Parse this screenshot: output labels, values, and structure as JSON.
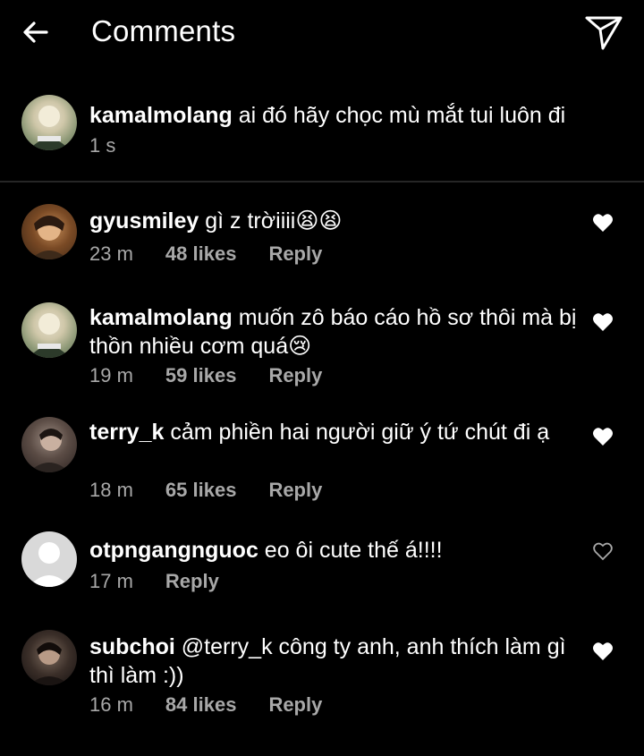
{
  "header": {
    "title": "Comments"
  },
  "caption": {
    "username": "kamalmolang",
    "text": "ai đó hãy chọc mù mắt tui luôn đi",
    "time": "1 s"
  },
  "comments": [
    {
      "username": "gyusmiley",
      "text": "gì z trờiiii😫😫",
      "time": "23 m",
      "likes": "48 likes",
      "reply": "Reply",
      "liked": true
    },
    {
      "username": "kamalmolang",
      "text": "muốn zô báo cáo hồ sơ thôi mà bị thồn nhiều cơm quá😢",
      "time": "19 m",
      "likes": "59 likes",
      "reply": "Reply",
      "liked": true
    },
    {
      "username": "terry_k",
      "text": "cảm phiền hai người giữ ý tứ chút đi ạ",
      "time": "18 m",
      "likes": "65 likes",
      "reply": "Reply",
      "liked": true
    },
    {
      "username": "otpngangnguoc",
      "text": "eo ôi cute thế á!!!!",
      "time": "17 m",
      "reply": "Reply",
      "liked": false
    },
    {
      "username": "subchoi",
      "text": "@terry_k công ty anh, anh thích làm gì thì làm :))",
      "time": "16 m",
      "likes": "84 likes",
      "reply": "Reply",
      "liked": true
    }
  ],
  "colors": {
    "background": "#000000",
    "text": "#ffffff",
    "meta": "#a8a8a8",
    "divider": "#262626"
  }
}
